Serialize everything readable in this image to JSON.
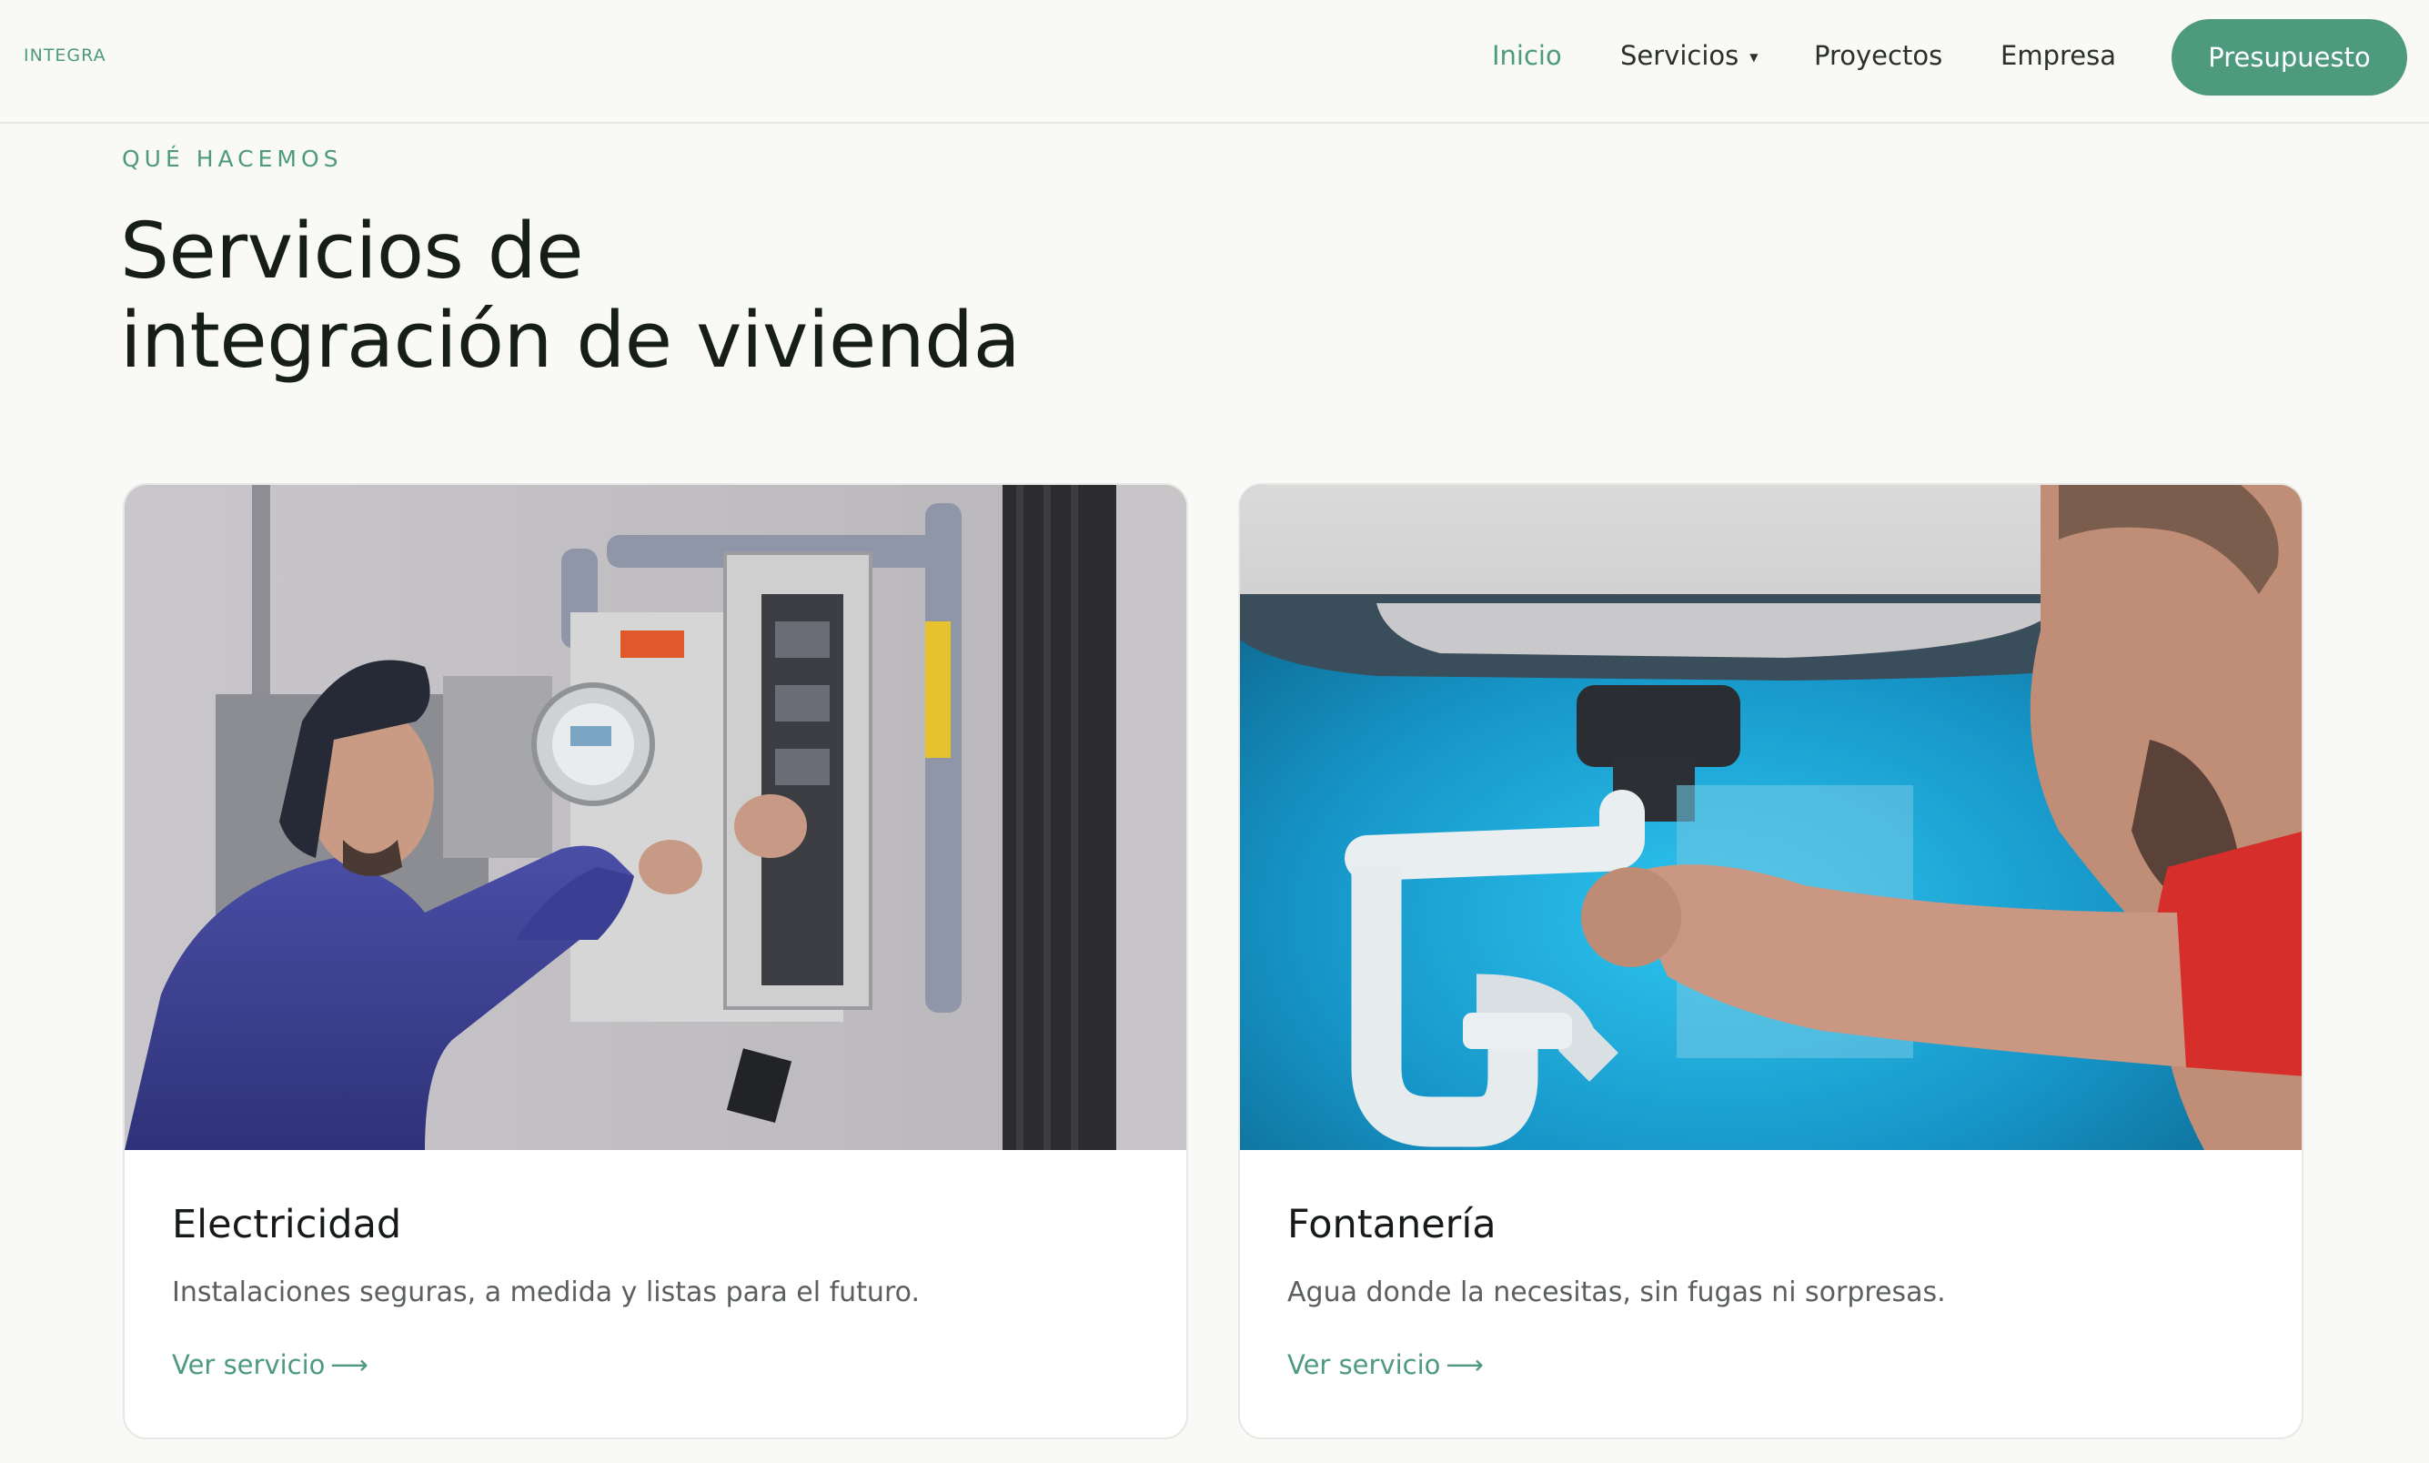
{
  "brand": {
    "logo_text": "INTEGRA",
    "accent_color": "#4e9a7e"
  },
  "nav": {
    "items": [
      {
        "label": "Inicio",
        "active": true
      },
      {
        "label": "Servicios",
        "has_dropdown": true
      },
      {
        "label": "Proyectos"
      },
      {
        "label": "Empresa"
      }
    ],
    "cta_label": "Presupuesto"
  },
  "section": {
    "eyebrow": "QUÉ HACEMOS",
    "title_line1": "Servicios de",
    "title_line2": "integración de vivienda"
  },
  "cards": [
    {
      "title": "Electricidad",
      "description": "Instalaciones seguras, a medida y listas para el futuro.",
      "link_label": "Ver servicio",
      "image": "electrician-working-on-breaker-panel"
    },
    {
      "title": "Fontanería",
      "description": "Agua donde la necesitas, sin fugas ni sorpresas.",
      "link_label": "Ver servicio",
      "image": "plumber-fixing-sink-pipes"
    }
  ],
  "icons": {
    "caret": "caret-down-icon",
    "arrow": "arrow-right-icon"
  }
}
